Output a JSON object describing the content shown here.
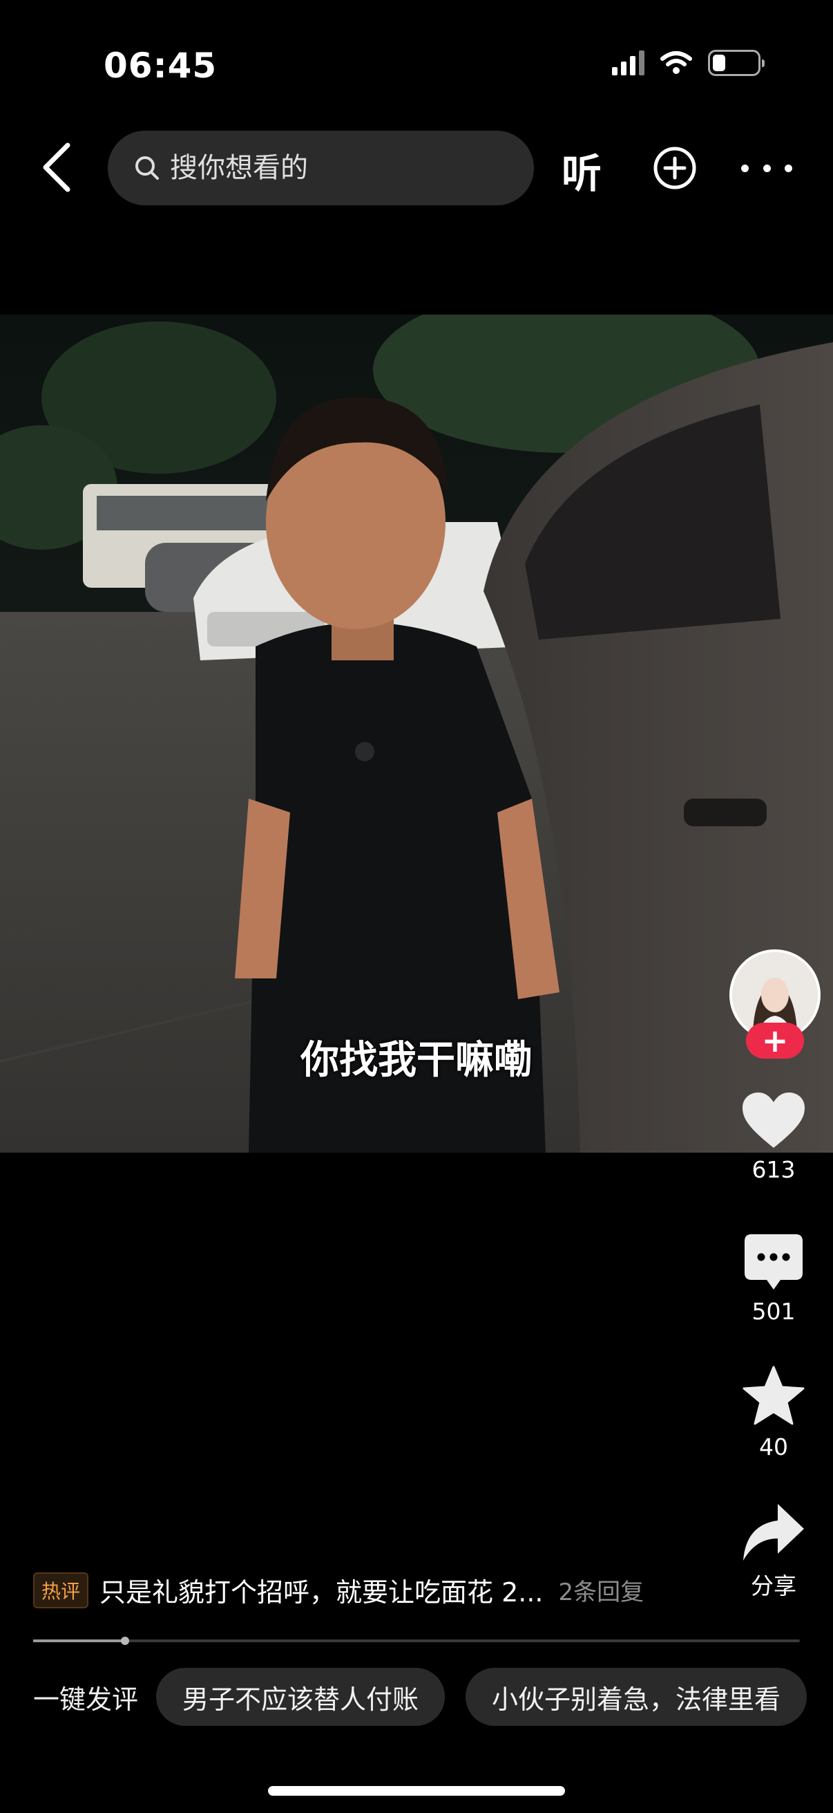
{
  "status_bar": {
    "time": "06:45"
  },
  "header": {
    "search_placeholder": "搜你想看的",
    "listen_label": "听"
  },
  "video": {
    "subtitle": "你找我干嘛嘞"
  },
  "right_rail": {
    "like_count": "613",
    "comment_count": "501",
    "favorite_count": "40",
    "share_label": "分享",
    "follow_icon": "plus-icon"
  },
  "hot_comment": {
    "badge": "热评",
    "text": "只是礼貌打个招呼，就要让吃面花 2...",
    "replies": "2条回复"
  },
  "progress": {
    "fraction": 0.12
  },
  "quick_comments": {
    "label": "一键发评",
    "chips": [
      "男子不应该替人付账",
      "小伙子别着急，法律里看"
    ]
  },
  "colors": {
    "follow": "#ee2a4b",
    "hot_badge": "#f5a142",
    "background": "#000000"
  }
}
